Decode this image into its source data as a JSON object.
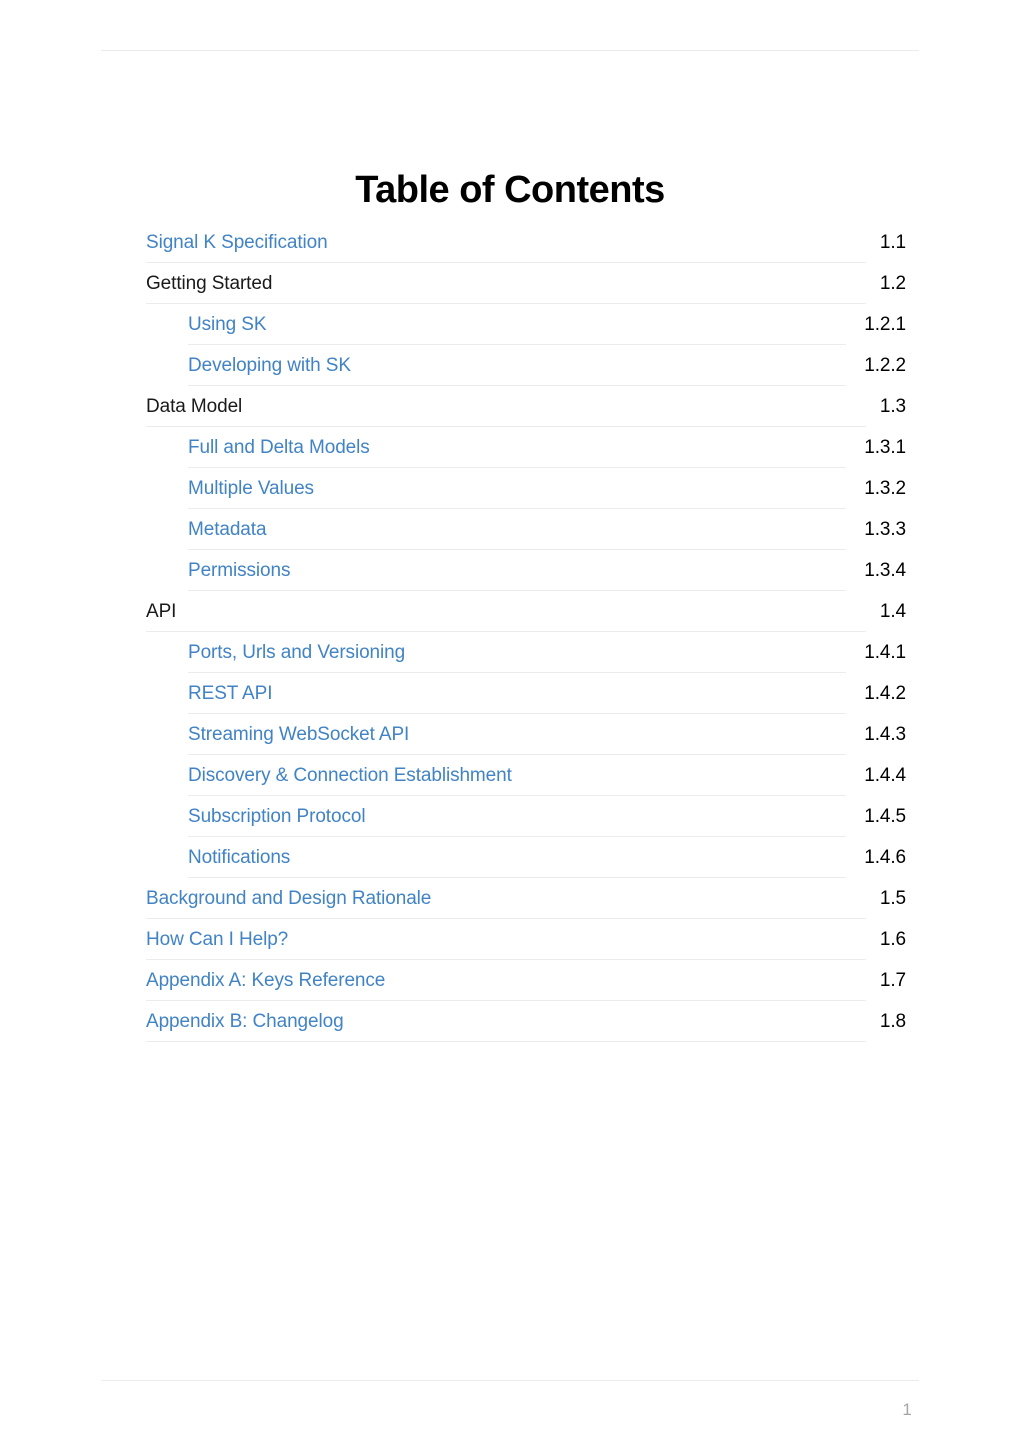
{
  "document": {
    "title": "Table of Contents",
    "page_number": "1",
    "link_color": "#4183c4",
    "text_color": "#1a1a1a",
    "rule_color": "#ececec"
  },
  "toc": {
    "entries": [
      {
        "label": "Signal K Specification",
        "number": "1.1",
        "level": 1,
        "is_link": true
      },
      {
        "label": "Getting Started",
        "number": "1.2",
        "level": 1,
        "is_link": false
      },
      {
        "label": "Using SK",
        "number": "1.2.1",
        "level": 2,
        "is_link": true
      },
      {
        "label": "Developing with SK",
        "number": "1.2.2",
        "level": 2,
        "is_link": true
      },
      {
        "label": "Data Model",
        "number": "1.3",
        "level": 1,
        "is_link": false
      },
      {
        "label": "Full and Delta Models",
        "number": "1.3.1",
        "level": 2,
        "is_link": true
      },
      {
        "label": "Multiple Values",
        "number": "1.3.2",
        "level": 2,
        "is_link": true
      },
      {
        "label": "Metadata",
        "number": "1.3.3",
        "level": 2,
        "is_link": true
      },
      {
        "label": "Permissions",
        "number": "1.3.4",
        "level": 2,
        "is_link": true
      },
      {
        "label": "API",
        "number": "1.4",
        "level": 1,
        "is_link": false
      },
      {
        "label": "Ports, Urls and Versioning",
        "number": "1.4.1",
        "level": 2,
        "is_link": true
      },
      {
        "label": "REST API",
        "number": "1.4.2",
        "level": 2,
        "is_link": true
      },
      {
        "label": "Streaming WebSocket API",
        "number": "1.4.3",
        "level": 2,
        "is_link": true
      },
      {
        "label": "Discovery & Connection Establishment",
        "number": "1.4.4",
        "level": 2,
        "is_link": true
      },
      {
        "label": "Subscription Protocol",
        "number": "1.4.5",
        "level": 2,
        "is_link": true
      },
      {
        "label": "Notifications",
        "number": "1.4.6",
        "level": 2,
        "is_link": true
      },
      {
        "label": "Background and Design Rationale",
        "number": "1.5",
        "level": 1,
        "is_link": true
      },
      {
        "label": "How Can I Help?",
        "number": "1.6",
        "level": 1,
        "is_link": true
      },
      {
        "label": "Appendix A: Keys Reference",
        "number": "1.7",
        "level": 1,
        "is_link": true
      },
      {
        "label": "Appendix B: Changelog",
        "number": "1.8",
        "level": 1,
        "is_link": true
      }
    ]
  }
}
